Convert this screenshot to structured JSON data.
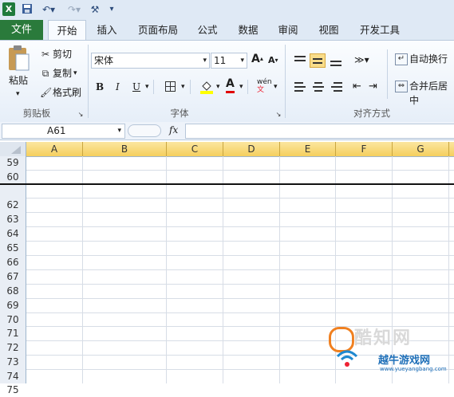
{
  "quick_access": {
    "logo": "X",
    "save_icon": "save-icon",
    "undo_icon": "undo-icon",
    "redo_icon": "redo-icon",
    "customize_icon": "customize-icon"
  },
  "tabs": [
    {
      "label": "文件"
    },
    {
      "label": "开始"
    },
    {
      "label": "插入"
    },
    {
      "label": "页面布局"
    },
    {
      "label": "公式"
    },
    {
      "label": "数据"
    },
    {
      "label": "审阅"
    },
    {
      "label": "视图"
    },
    {
      "label": "开发工具"
    }
  ],
  "clipboard": {
    "paste": "粘贴",
    "cut": "剪切",
    "copy": "复制",
    "format_painter": "格式刷",
    "group": "剪贴板"
  },
  "font": {
    "name": "宋体",
    "size": "11",
    "bold": "B",
    "italic": "I",
    "underline": "U",
    "group": "字体",
    "grow": "A",
    "shrink": "A",
    "font_color": "A",
    "phonetic": "wén"
  },
  "alignment": {
    "wrap": "自动换行",
    "merge": "合并后居中",
    "group": "对齐方式"
  },
  "formula_bar": {
    "name_box": "A61",
    "fx": "fx",
    "formula": ""
  },
  "columns": [
    "A",
    "B",
    "C",
    "D",
    "E",
    "F",
    "G"
  ],
  "rows": [
    "59",
    "60",
    "62",
    "63",
    "64",
    "65",
    "66",
    "67",
    "68",
    "69",
    "70",
    "71",
    "72",
    "73",
    "74",
    "75"
  ],
  "watermark": {
    "text1": "酷知网",
    "text2": "越牛游戏网",
    "url": "www.yueyangbang.com"
  },
  "colors": {
    "file_tab": "#2a7a3b",
    "selected_header": "#f5cf5d",
    "ribbon_bg": "#e6eef8"
  }
}
